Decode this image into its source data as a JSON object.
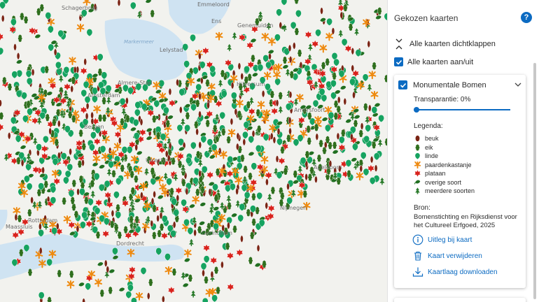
{
  "map": {
    "places": [
      "Schagerbrug",
      "Emmeloord",
      "Ens",
      "Genemuiden",
      "Markermeer",
      "Lelystad",
      "Almere-Stad",
      "Amsterdam",
      "Hilversum",
      "Amersfoort",
      "Apeldoorn",
      "Nijmegen",
      "Utrecht",
      "Rotterdam",
      "Dordrecht",
      "Maassluis",
      "Gorinchem",
      "Bergen"
    ],
    "colors": {
      "beuk": "#7a2414",
      "eik": "#2f6f1e",
      "linde": "#16a360",
      "paardenkastanje": "#ee8a10",
      "plataan": "#d9231d",
      "overige": "#216f21",
      "meerdere": "#2a7a2a",
      "land": "#f2f2ee",
      "water": "#cfe3f2"
    }
  },
  "panel": {
    "title": "Gekozen kaarten",
    "help_icon": "?",
    "collapse_all": "Alle kaarten dichtklappen",
    "toggle_all": "Alle kaarten aan/uit",
    "card": {
      "title": "Monumentale Bomen",
      "transparency": "Transparantie: 0%",
      "transparency_value": 0,
      "legend_title": "Legenda:",
      "legend": [
        {
          "label": "beuk",
          "icon": "beuk-leaf-icon",
          "color": "#7a2414"
        },
        {
          "label": "eik",
          "icon": "eik-leaf-icon",
          "color": "#2f6f1e"
        },
        {
          "label": "linde",
          "icon": "linde-leaf-icon",
          "color": "#16a360"
        },
        {
          "label": "paardenkastanje",
          "icon": "paardenkastanje-leaf-icon",
          "color": "#ee8a10"
        },
        {
          "label": "plataan",
          "icon": "plataan-leaf-icon",
          "color": "#d9231d"
        },
        {
          "label": "overige soort",
          "icon": "overige-soort-leaf-icon",
          "color": "#216f21"
        },
        {
          "label": "meerdere soorten",
          "icon": "meerdere-soorten-leaf-icon",
          "color": "#2a7a2a"
        }
      ],
      "source_title": "Bron:",
      "source_text": "Bomenstichting en Rijksdienst voor het Cultureel Erfgoed, 2025",
      "actions": [
        {
          "label": "Uitleg bij kaart",
          "icon": "info-icon"
        },
        {
          "label": "Kaart verwijderen",
          "icon": "trash-icon"
        },
        {
          "label": "Kaartlaag downloaden",
          "icon": "download-icon"
        }
      ]
    }
  }
}
